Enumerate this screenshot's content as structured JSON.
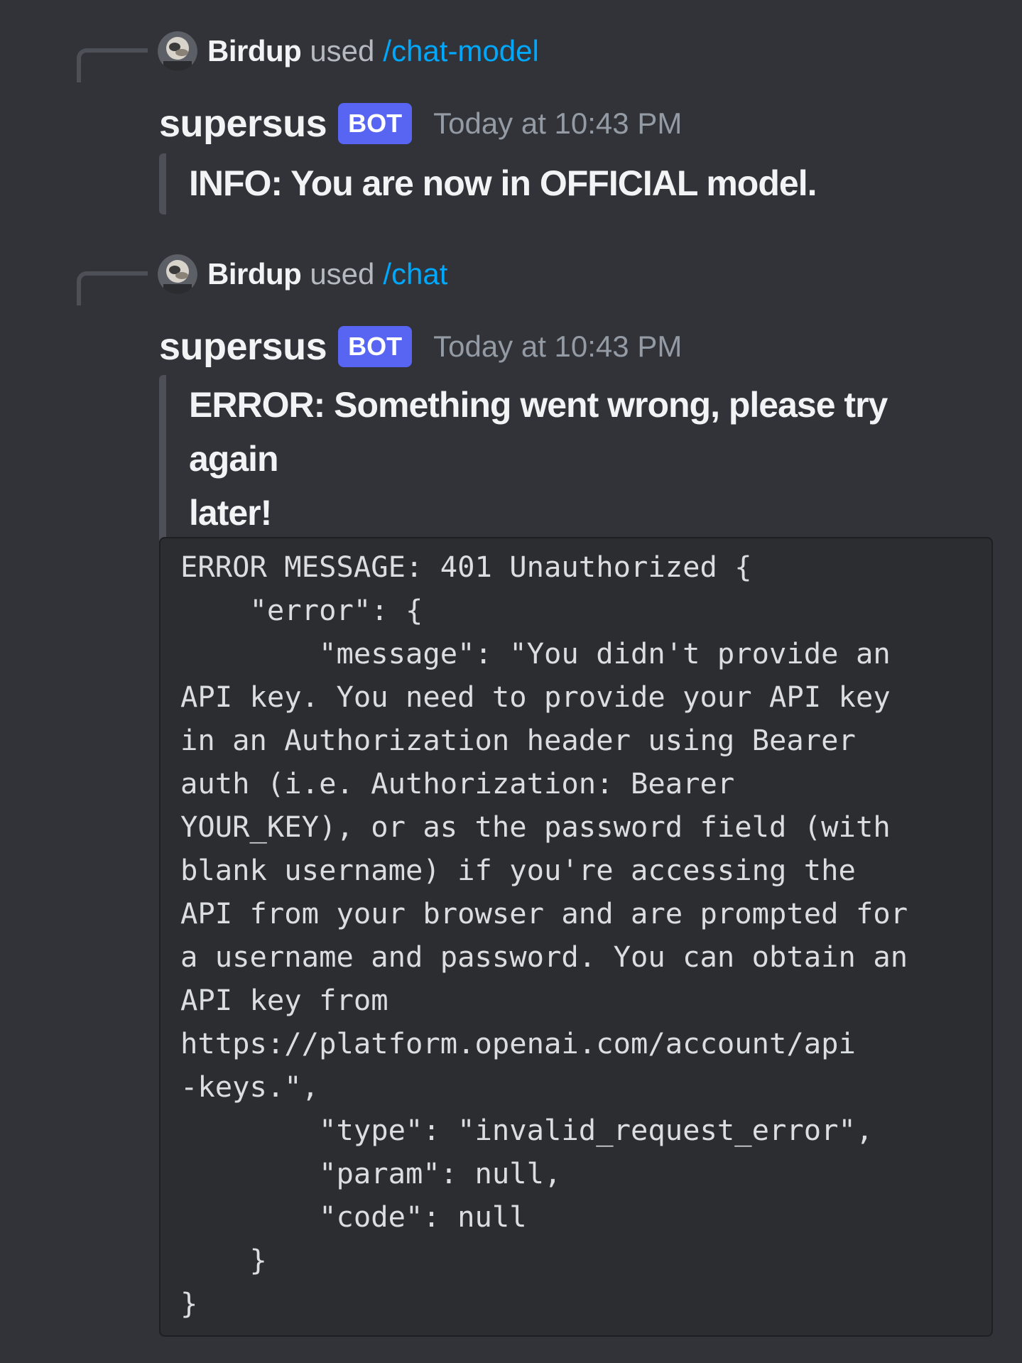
{
  "messages": [
    {
      "invoker": {
        "avatar_icon": "user-avatar",
        "name": "Birdup",
        "used": "used",
        "command": "/chat-model"
      },
      "author": {
        "name": "supersus",
        "tag": "BOT",
        "timestamp": "Today at 10:43 PM"
      },
      "embed_text": "INFO: You are now in OFFICIAL model."
    },
    {
      "invoker": {
        "avatar_icon": "user-avatar",
        "name": "Birdup",
        "used": "used",
        "command": "/chat"
      },
      "author": {
        "name": "supersus",
        "tag": "BOT",
        "timestamp": "Today at 10:43 PM"
      },
      "embed_text": "ERROR: Something went wrong, please try again later!",
      "embed_lines": [
        "ERROR: Something went wrong, please try again",
        "later!"
      ],
      "code_block": "ERROR MESSAGE: 401 Unauthorized {\n    \"error\": {\n        \"message\": \"You didn't provide an\nAPI key. You need to provide your API key\nin an Authorization header using Bearer\nauth (i.e. Authorization: Bearer\nYOUR_KEY), or as the password field (with\nblank username) if you're accessing the\nAPI from your browser and are prompted for\na username and password. You can obtain an\nAPI key from\nhttps://platform.openai.com/account/api\n-keys.\",\n        \"type\": \"invalid_request_error\",\n        \"param\": null,\n        \"code\": null\n    }\n}"
    }
  ],
  "colors": {
    "background": "#313338",
    "command_link": "#00a8fc",
    "bot_tag": "#5865f2",
    "embed_border": "#4e5058",
    "code_background": "#2b2d31"
  }
}
